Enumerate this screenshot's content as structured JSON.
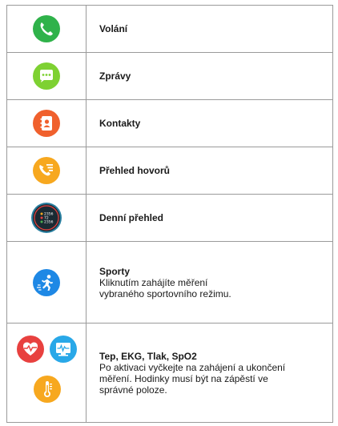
{
  "rows": [
    {
      "icon": "phone-icon",
      "color": "#2fb24a",
      "name": "Volání",
      "desc": ""
    },
    {
      "icon": "chat-bubble-icon",
      "color": "#7ed132",
      "name": "Zprávy",
      "desc": ""
    },
    {
      "icon": "contacts-icon",
      "color": "#f0602d",
      "name": "Kontakty",
      "desc": ""
    },
    {
      "icon": "call-log-icon",
      "color": "#f7a81f",
      "name": "Přehled hovorů",
      "desc": ""
    },
    {
      "icon": "daily-overview-icon",
      "color": "#1a2a33",
      "name": "Denní přehled",
      "desc": ""
    },
    {
      "icon": "running-icon",
      "color": "#1e88e5",
      "name": "Sporty",
      "desc": "Kliknutím zahájíte měření vybraného sportovního režimu."
    },
    {
      "icon": "heart-rate-icon",
      "color": "#e8413f",
      "name": "Tep, EKG, Tlak, SpO2",
      "desc": "Po aktivaci vyčkejte na zahájení a ukončení měření. Hodinky musí být na zápěstí ve správné poloze."
    }
  ],
  "extra_icons": [
    {
      "icon": "ecg-monitor-icon",
      "color": "#29a8e8"
    },
    {
      "icon": "thermometer-icon",
      "color": "#f7a81f"
    }
  ],
  "overview_readout": [
    "2356",
    "72",
    "2356"
  ]
}
